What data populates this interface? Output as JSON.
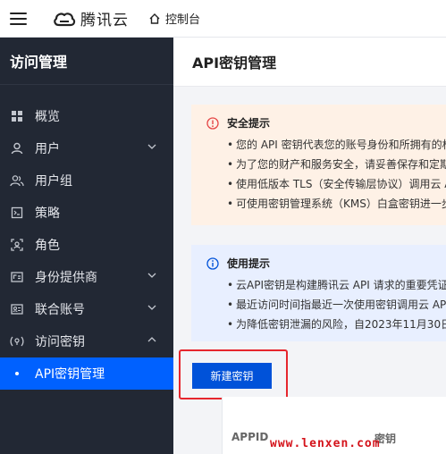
{
  "topbar": {
    "logo_text": "腾讯云",
    "console_label": "控制台"
  },
  "sidebar": {
    "title": "访问管理",
    "items": [
      {
        "label": "概览",
        "icon": "overview-icon"
      },
      {
        "label": "用户",
        "icon": "user-icon",
        "has_chevron": "down"
      },
      {
        "label": "用户组",
        "icon": "user-group-icon"
      },
      {
        "label": "策略",
        "icon": "policy-icon"
      },
      {
        "label": "角色",
        "icon": "role-icon"
      },
      {
        "label": "身份提供商",
        "icon": "identity-provider-icon",
        "has_chevron": "down"
      },
      {
        "label": "联合账号",
        "icon": "federated-account-icon",
        "has_chevron": "down"
      },
      {
        "label": "访问密钥",
        "icon": "access-key-icon",
        "has_chevron": "up"
      },
      {
        "label": "API密钥管理",
        "active": true
      }
    ]
  },
  "main": {
    "page_title": "API密钥管理",
    "security_notice": {
      "title": "安全提示",
      "items": [
        "您的 API 密钥代表您的账号身份和所拥有的权",
        "为了您的财产和服务安全，请妥善保存和定期更",
        "使用低版本 TLS（安全传输层协议）调用云 API",
        "可使用密钥管理系统（KMS）白盒密钥进一步"
      ]
    },
    "usage_notice": {
      "title": "使用提示",
      "items": [
        "云API密钥是构建腾讯云 API 请求的重要凭证",
        "最近访问时间指最近一次使用密钥调用云 API",
        "为降低密钥泄漏的风险，自2023年11月30日起"
      ]
    },
    "create_button": "新建密钥",
    "table": {
      "columns": [
        "APPID",
        "密钥"
      ]
    }
  },
  "watermark": "www.lenxen.com",
  "colors": {
    "sidebar_bg": "#222834",
    "active_item": "#0061ff",
    "primary_button": "#0052d9",
    "warn_bg": "#fef1e6",
    "info_bg": "#e8efff",
    "highlight": "#e6262d"
  }
}
